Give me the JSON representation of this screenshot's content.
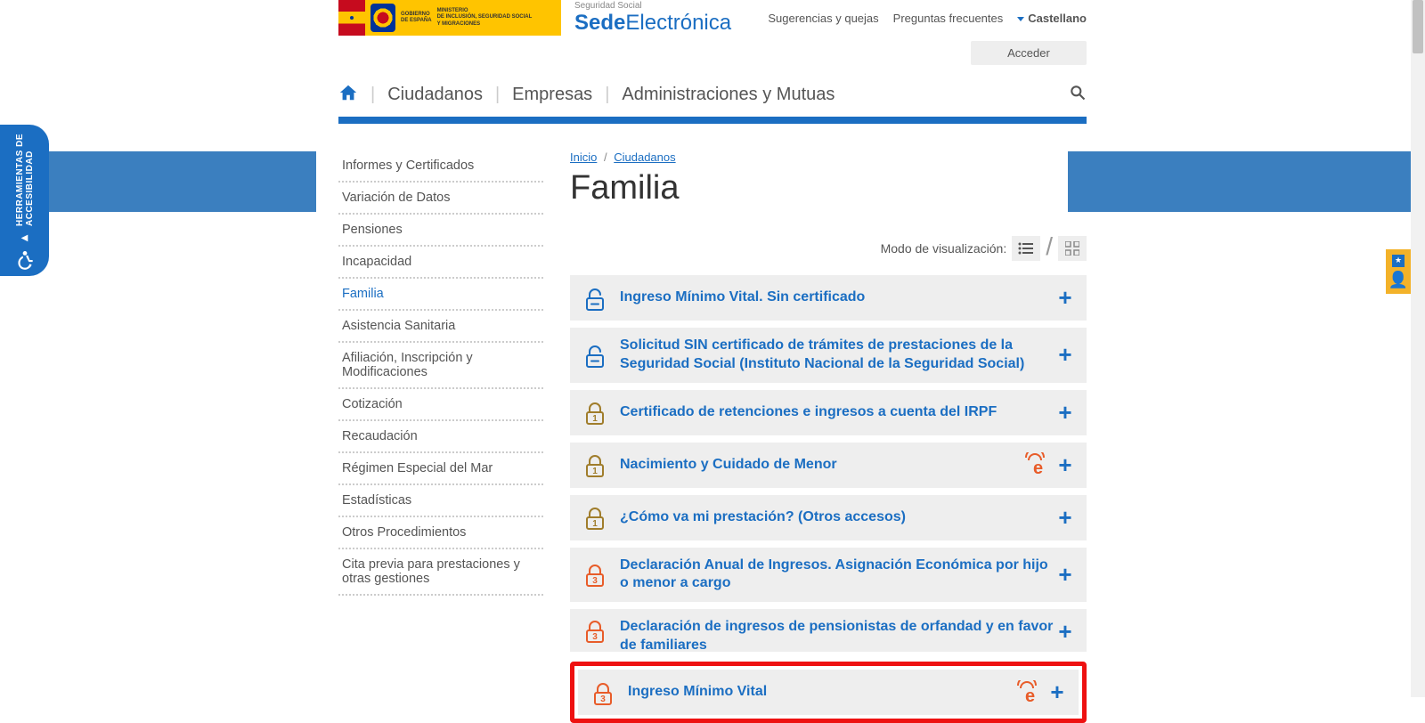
{
  "header": {
    "gov1": "GOBIERNO",
    "gov2": "DE ESPAÑA",
    "min1": "MINISTERIO",
    "min2": "DE INCLUSIÓN, SEGURIDAD SOCIAL",
    "min3": "Y MIGRACIONES",
    "sede_small": "Seguridad Social",
    "sede_bold": "Sede",
    "sede_light": "Electrónica",
    "link_sug": "Sugerencias y quejas",
    "link_faq": "Preguntas frecuentes",
    "lang": "Castellano",
    "acceder": "Acceder"
  },
  "nav": {
    "ciudadanos": "Ciudadanos",
    "empresas": "Empresas",
    "admin": "Administraciones y Mutuas"
  },
  "a11y": {
    "label": "HERRAMIENTAS DE ACCESIBILIDAD"
  },
  "sidebar": {
    "items": [
      "Informes y Certificados",
      "Variación de Datos",
      "Pensiones",
      "Incapacidad",
      "Familia",
      "Asistencia Sanitaria",
      "Afiliación, Inscripción y Modificaciones",
      "Cotización",
      "Recaudación",
      "Régimen Especial del Mar",
      "Estadísticas",
      "Otros Procedimientos",
      "Cita previa para prestaciones y otras gestiones"
    ]
  },
  "breadcrumb": {
    "inicio": "Inicio",
    "ciud": "Ciudadanos"
  },
  "title": "Familia",
  "viewmode": {
    "label": "Modo de visualización:"
  },
  "procedures": [
    {
      "title": "Ingreso Mínimo Vital. Sin certificado",
      "lock": "open-blue",
      "badge": false
    },
    {
      "title": "Solicitud SIN certificado de trámites de prestaciones de la Seguridad Social (Instituto Nacional de la Seguridad Social)",
      "lock": "open-blue",
      "badge": false
    },
    {
      "title": "Certificado de retenciones e ingresos a cuenta del IRPF",
      "lock": "1-olive",
      "badge": false
    },
    {
      "title": "Nacimiento y Cuidado de Menor",
      "lock": "1-olive",
      "badge": true
    },
    {
      "title": "¿Cómo va mi prestación? (Otros accesos)",
      "lock": "1-olive",
      "badge": false
    },
    {
      "title": "Declaración Anual de Ingresos. Asignación Económica por hijo o menor a cargo",
      "lock": "3-orange",
      "badge": false
    },
    {
      "title": "Declaración de ingresos de pensionistas de orfandad y en favor de familiares",
      "lock": "3-orange",
      "badge": false,
      "cut": true
    },
    {
      "title": "Ingreso Mínimo Vital",
      "lock": "3-orange",
      "badge": true,
      "highlight": true
    }
  ],
  "colors": {
    "brand": "#1b6ec2",
    "olive": "#a07d2b",
    "orange": "#e85c29"
  }
}
